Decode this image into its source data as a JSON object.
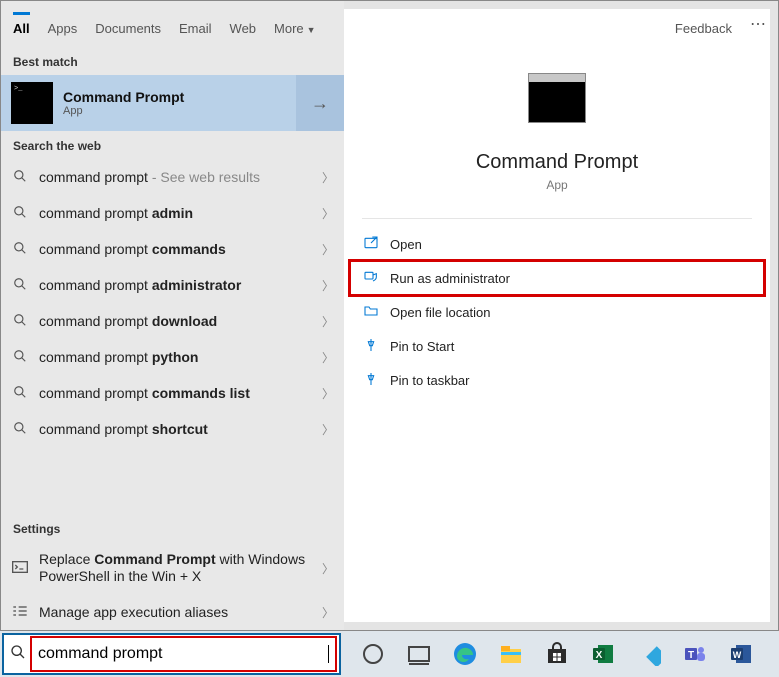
{
  "tabs": {
    "items": [
      "All",
      "Apps",
      "Documents",
      "Email",
      "Web",
      "More"
    ],
    "active_index": 0,
    "feedback": "Feedback"
  },
  "sections": {
    "best_match": "Best match",
    "search_web": "Search the web",
    "settings": "Settings"
  },
  "best_match": {
    "title": "Command Prompt",
    "subtitle": "App"
  },
  "web_results": [
    {
      "prefix": "command prompt",
      "bold": "",
      "suffix_muted": " - See web results"
    },
    {
      "prefix": "command prompt ",
      "bold": "admin",
      "suffix_muted": ""
    },
    {
      "prefix": "command prompt ",
      "bold": "commands",
      "suffix_muted": ""
    },
    {
      "prefix": "command prompt ",
      "bold": "administrator",
      "suffix_muted": ""
    },
    {
      "prefix": "command prompt ",
      "bold": "download",
      "suffix_muted": ""
    },
    {
      "prefix": "command prompt ",
      "bold": "python",
      "suffix_muted": ""
    },
    {
      "prefix": "command prompt ",
      "bold": "commands list",
      "suffix_muted": ""
    },
    {
      "prefix": "command prompt ",
      "bold": "shortcut",
      "suffix_muted": ""
    }
  ],
  "settings_results": [
    {
      "icon": "cmd",
      "html": "Replace <b>Command Prompt</b> with Windows PowerShell in the Win + X"
    },
    {
      "icon": "list",
      "html": "Manage app execution aliases"
    }
  ],
  "preview": {
    "title": "Command Prompt",
    "subtitle": "App",
    "actions": [
      {
        "icon": "open",
        "label": "Open",
        "highlight": false
      },
      {
        "icon": "shield",
        "label": "Run as administrator",
        "highlight": true
      },
      {
        "icon": "folder",
        "label": "Open file location",
        "highlight": false
      },
      {
        "icon": "pin-start",
        "label": "Pin to Start",
        "highlight": false
      },
      {
        "icon": "pin-taskbar",
        "label": "Pin to taskbar",
        "highlight": false
      }
    ]
  },
  "search": {
    "value": "command prompt"
  },
  "taskbar_icons": [
    "cortana",
    "task-view",
    "edge",
    "explorer",
    "store",
    "excel",
    "kodi",
    "teams",
    "word"
  ]
}
